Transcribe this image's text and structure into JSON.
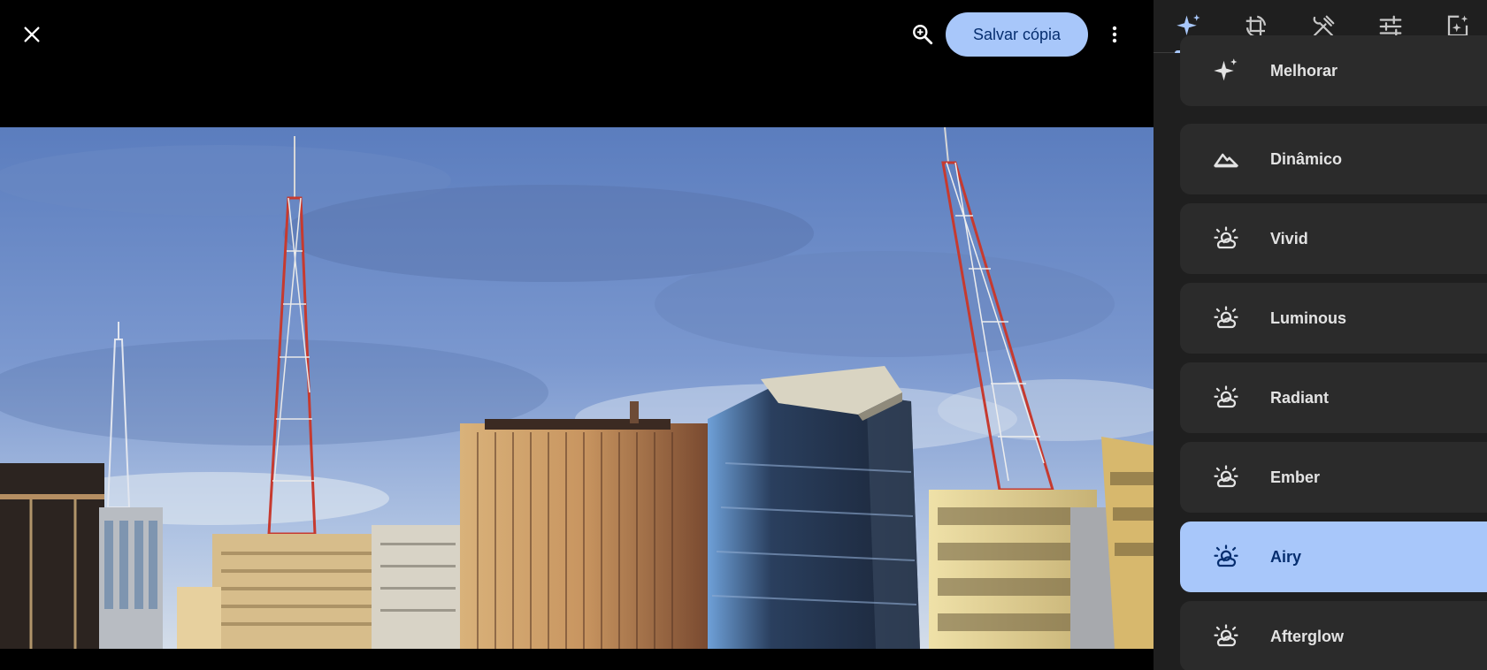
{
  "topbar": {
    "close_icon": "close-icon",
    "zoom_icon": "zoom-in-icon",
    "save_label": "Salvar cópia",
    "more_icon": "more-vert-icon"
  },
  "tabs": [
    {
      "name": "suggestions",
      "icon": "sparkle-icon",
      "active": true
    },
    {
      "name": "crop-rotate",
      "icon": "crop-rotate-icon",
      "active": false
    },
    {
      "name": "tools",
      "icon": "tools-icon",
      "active": false
    },
    {
      "name": "adjust",
      "icon": "sliders-icon",
      "active": false
    },
    {
      "name": "filters",
      "icon": "filter-icon",
      "active": false
    }
  ],
  "presets": [
    {
      "label": "Melhorar",
      "icon": "sparkle-icon",
      "selected": false
    },
    {
      "label": "Dinâmico",
      "icon": "mountain-icon",
      "selected": false
    },
    {
      "label": "Vivid",
      "icon": "sun-cloud-icon",
      "selected": false
    },
    {
      "label": "Luminous",
      "icon": "sun-cloud-icon",
      "selected": false
    },
    {
      "label": "Radiant",
      "icon": "sun-cloud-icon",
      "selected": false
    },
    {
      "label": "Ember",
      "icon": "sun-cloud-icon",
      "selected": false
    },
    {
      "label": "Airy",
      "icon": "sun-cloud-icon",
      "selected": true
    },
    {
      "label": "Afterglow",
      "icon": "sun-cloud-icon",
      "selected": false
    }
  ],
  "colors": {
    "accent": "#a8c7fa",
    "accent_text": "#062e6f",
    "panel_bg": "#1f1f1f",
    "card_bg": "#2b2b2b"
  }
}
